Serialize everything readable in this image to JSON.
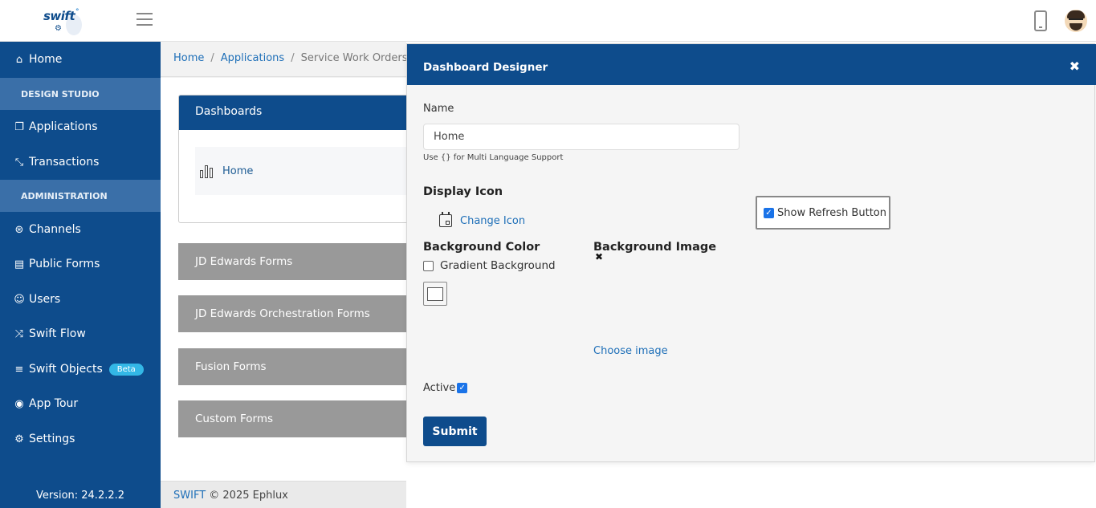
{
  "header": {
    "logo_text": "swift",
    "hamburger_icon": "hamburger-icon",
    "device_icon": "mobile-phone-icon",
    "avatar_icon": "user-avatar"
  },
  "sidebar": {
    "items": [
      {
        "label": "Home",
        "icon": "home-icon"
      },
      {
        "section": "DESIGN STUDIO"
      },
      {
        "label": "Applications",
        "icon": "applications-icon"
      },
      {
        "label": "Transactions",
        "icon": "transactions-icon"
      },
      {
        "section": "ADMINISTRATION"
      },
      {
        "label": "Channels",
        "icon": "channels-icon"
      },
      {
        "label": "Public Forms",
        "icon": "public-forms-icon"
      },
      {
        "label": "Users",
        "icon": "users-icon"
      },
      {
        "label": "Swift Flow",
        "icon": "shuffle-icon"
      },
      {
        "label": "Swift Objects",
        "icon": "database-icon",
        "badge": "Beta"
      },
      {
        "label": "App Tour",
        "icon": "compass-icon"
      },
      {
        "label": "Settings",
        "icon": "gear-icon"
      }
    ],
    "version": "Version: 24.2.2.2"
  },
  "breadcrumb": {
    "home": "Home",
    "applications": "Applications",
    "current": "Service Work Orders"
  },
  "main": {
    "dashboards_title": "Dashboards",
    "dashboard_item": "Home",
    "forms": [
      "JD Edwards Forms",
      "JD Edwards Orchestration Forms",
      "Fusion Forms",
      "Custom Forms"
    ]
  },
  "footer": {
    "brand": "SWIFT",
    "copyright": " © 2025 Ephlux"
  },
  "modal": {
    "title": "Dashboard Designer",
    "name_label": "Name",
    "name_value": "Home",
    "name_hint": "Use {} for Multi Language Support",
    "display_icon_heading": "Display Icon",
    "change_icon_label": "Change Icon",
    "show_refresh_label": "Show Refresh Button",
    "show_refresh_checked": true,
    "background_color_heading": "Background Color",
    "gradient_label": "Gradient Background",
    "gradient_checked": false,
    "background_image_heading": "Background Image",
    "choose_image_label": "Choose image",
    "active_label": "Active",
    "active_checked": true,
    "submit_label": "Submit"
  },
  "colors": {
    "primary": "#0e4c8c",
    "section_bg": "#3a6fa8",
    "link": "#1e6fb8",
    "form_block": "#999999",
    "beta_badge": "#33b7e6"
  }
}
